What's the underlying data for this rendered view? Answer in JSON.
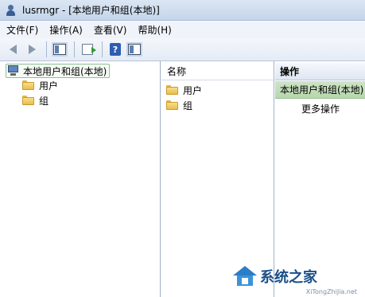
{
  "window": {
    "title": "lusrmgr - [本地用户和组(本地)]"
  },
  "menubar": {
    "items": [
      {
        "label": "文件(F)"
      },
      {
        "label": "操作(A)"
      },
      {
        "label": "查看(V)"
      },
      {
        "label": "帮助(H)"
      }
    ]
  },
  "toolbar": {
    "icons": [
      "back-arrow-icon",
      "forward-arrow-icon",
      "show-hide-tree-icon",
      "export-list-icon",
      "help-icon",
      "show-hide-action-pane-icon"
    ]
  },
  "tree": {
    "root_label": "本地用户和组(本地)",
    "children": [
      {
        "label": "用户",
        "icon": "folder-icon"
      },
      {
        "label": "组",
        "icon": "folder-icon"
      }
    ]
  },
  "list": {
    "column_header": "名称",
    "items": [
      {
        "label": "用户",
        "icon": "folder-icon"
      },
      {
        "label": "组",
        "icon": "folder-icon"
      }
    ]
  },
  "actions": {
    "header": "操作",
    "section_title": "本地用户和组(本地)",
    "items": [
      {
        "label": "更多操作"
      }
    ]
  },
  "watermark": {
    "text": "系统之家",
    "url": "XiTongZhiJia.net"
  },
  "colors": {
    "titlebar": "#c4d5ea",
    "selection_green": "#b7d6ad",
    "folder": "#e8bd4c",
    "watermark_blue": "#1b4f8a"
  }
}
